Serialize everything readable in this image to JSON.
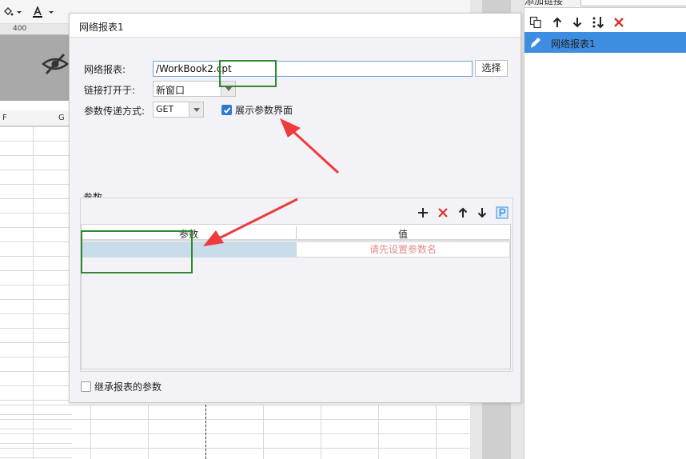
{
  "background": {
    "ruler_label": "400",
    "col_f": "F",
    "col_g": "G"
  },
  "right_panel": {
    "header_label": "添加链接",
    "link_item": "网络报表1",
    "colors": {
      "selected": "#3d8ee0",
      "delete": "#d93025"
    }
  },
  "dialog": {
    "title": "网络报表1",
    "report_label": "网络报表:",
    "report_value": "/WorkBook2.cpt",
    "choose_button": "选择",
    "open_in_label": "链接打开于:",
    "open_in_value": "新窗口",
    "param_method_label": "参数传递方式:",
    "param_method_value": "GET",
    "show_params_label": "展示参数界面",
    "show_params_checked": true,
    "params_section": "参数",
    "table": {
      "col_name": "参数",
      "col_value": "值",
      "row_value_placeholder": "请先设置参数名"
    },
    "inherit_label": "继承报表的参数",
    "inherit_checked": false
  },
  "annotation_colors": {
    "box": "#2f8a2f",
    "arrow": "#ee3b3b"
  }
}
